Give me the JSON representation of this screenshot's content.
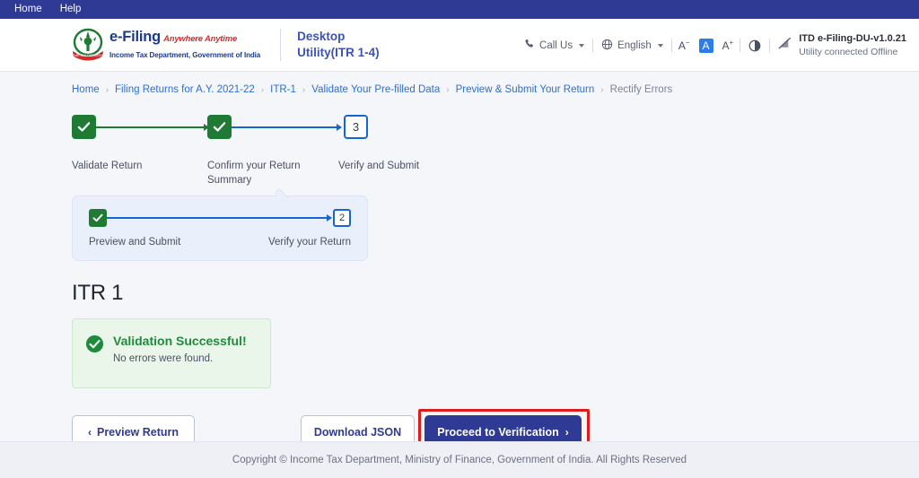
{
  "menubar": {
    "items": [
      {
        "label": "Home",
        "name": "menu-home"
      },
      {
        "label": "Help",
        "name": "menu-help"
      }
    ]
  },
  "header": {
    "logo": {
      "brand": "e-Filing",
      "tagline": "Anywhere Anytime",
      "department": "Income Tax Department, Government of India",
      "emblem_icon": "india-national-emblem-icon"
    },
    "utility_title_line1": "Desktop",
    "utility_title_line2": "Utility(ITR 1-4)",
    "call_us": {
      "label": "Call Us",
      "icon": "phone-icon"
    },
    "language": {
      "label": "English",
      "icon": "globe-icon"
    },
    "font_decrease": "A",
    "font_normal": "A",
    "font_increase": "A",
    "contrast_icon": "contrast-toggle-icon",
    "version": "ITD e-Filing-DU-v1.0.21",
    "connection_status": "Utility connected Offline",
    "connection_icon": "signal-off-icon"
  },
  "breadcrumb": {
    "items": [
      {
        "label": "Home",
        "current": false
      },
      {
        "label": "Filing Returns for A.Y. 2021-22",
        "current": false
      },
      {
        "label": "ITR-1",
        "current": false
      },
      {
        "label": "Validate Your Pre-filled Data",
        "current": false
      },
      {
        "label": "Preview & Submit Your Return",
        "current": false
      },
      {
        "label": "Rectify Errors",
        "current": true
      }
    ],
    "separator": "›"
  },
  "stepper": {
    "steps": [
      {
        "label": "Validate Return",
        "state": "done",
        "marker": "check"
      },
      {
        "label": "Confirm your Return Summary",
        "state": "done",
        "marker": "check"
      },
      {
        "label": "Verify and Submit",
        "state": "current",
        "marker": "3"
      }
    ]
  },
  "substepper": {
    "steps": [
      {
        "label": "Preview and Submit",
        "state": "done",
        "marker": "check"
      },
      {
        "label": "Verify your Return",
        "state": "current",
        "marker": "2"
      }
    ]
  },
  "main": {
    "page_title": "ITR 1",
    "alert": {
      "icon": "success-check-circle-icon",
      "title": "Validation Successful!",
      "subtitle": "No errors were found."
    },
    "buttons": {
      "preview_return": "Preview Return",
      "preview_chevron": "‹",
      "download_json": "Download JSON",
      "proceed": "Proceed to Verification",
      "proceed_chevron": "›"
    }
  },
  "footer": {
    "copyright": "Copyright © Income Tax Department, Ministry of Finance, Government of India. All Rights Reserved"
  },
  "colors": {
    "navbar": "#2e3a93",
    "primary_button": "#2e3a93",
    "link": "#2b6fd4",
    "success": "#1f7a34",
    "highlight_box": "#e01b1b",
    "page_background": "#f5f6fa"
  }
}
